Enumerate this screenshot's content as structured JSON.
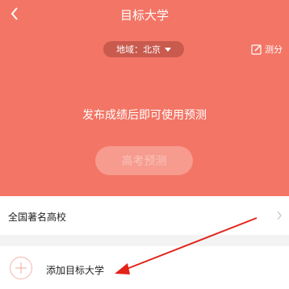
{
  "header": {
    "title": "目标大学",
    "back_icon": "chevron-left-icon"
  },
  "hero": {
    "region_label": "地域：北京",
    "region_icon": "caret-down-icon",
    "test_label": "测分",
    "test_icon": "edit-icon",
    "notice": "发布成绩后即可使用预测",
    "predict_button": "高考预测"
  },
  "list": {
    "famous_schools_label": "全国著名高校",
    "famous_icon": "chevron-right-icon",
    "add_target_label": "添加目标大学",
    "add_icon": "plus-circle-icon"
  },
  "colors": {
    "brand": "#f37565",
    "pill": "#c85a4e",
    "annotation_arrow": "#e2231a"
  }
}
